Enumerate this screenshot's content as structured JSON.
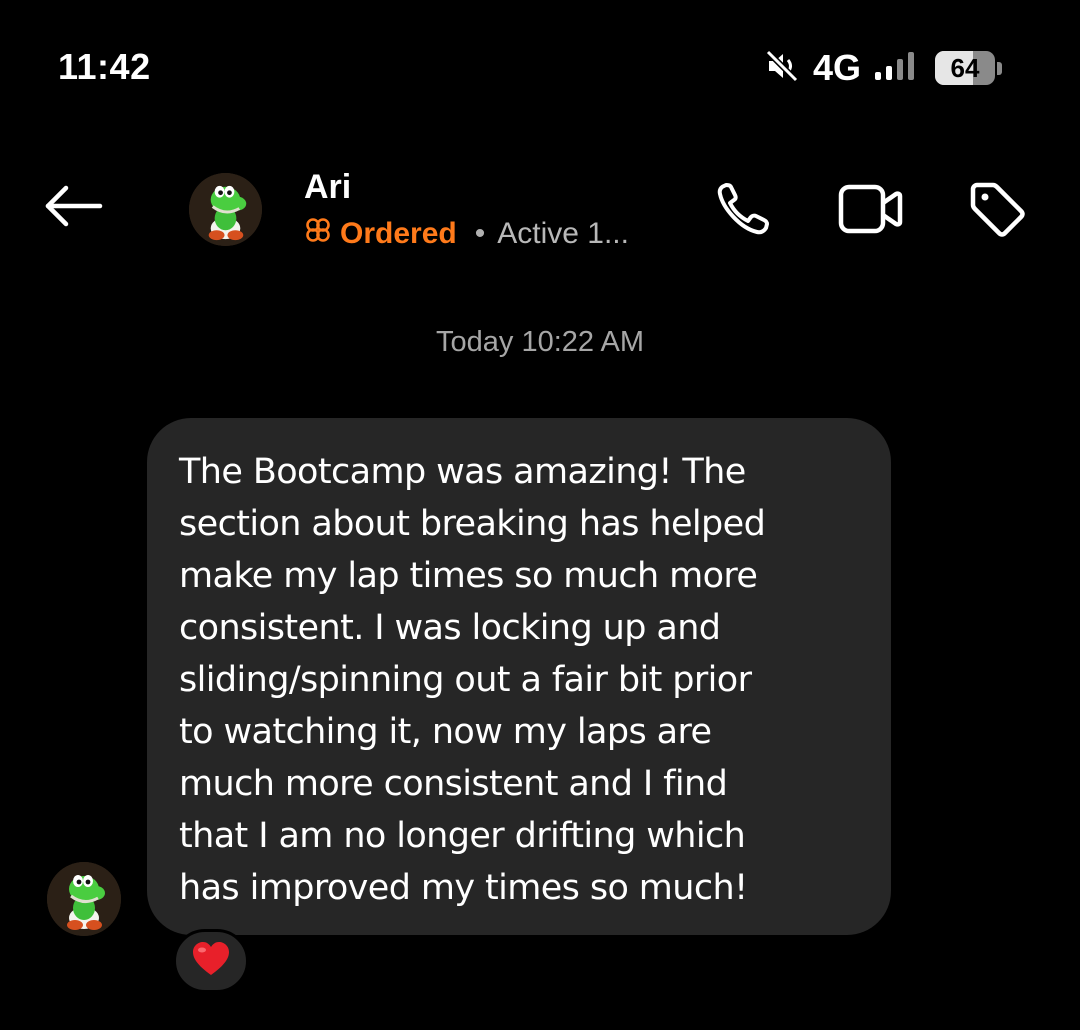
{
  "status_bar": {
    "time": "11:42",
    "network": "4G",
    "battery_level": "64",
    "icons": [
      "mute-icon",
      "signal-icon",
      "battery-icon"
    ]
  },
  "header": {
    "contact_name": "Ari",
    "order_status": "Ordered",
    "separator": "•",
    "activity": "Active 1...",
    "actions": [
      "back-arrow-icon",
      "phone-icon",
      "video-icon",
      "tag-icon"
    ],
    "accent_color": "#ff7a1a"
  },
  "conversation": {
    "timestamp": "Today 10:22 AM",
    "message": {
      "text": "The Bootcamp was amazing! The\nsection about breaking has helped\nmake my lap times so much more\nconsistent. I was locking up and\nsliding/spinning out a fair bit prior\nto watching it, now my laps are\nmuch more consistent and I find\nthat I am no longer drifting which\nhas improved my times so much!",
      "bubble_color": "#262626"
    },
    "reaction": "heart-icon"
  }
}
